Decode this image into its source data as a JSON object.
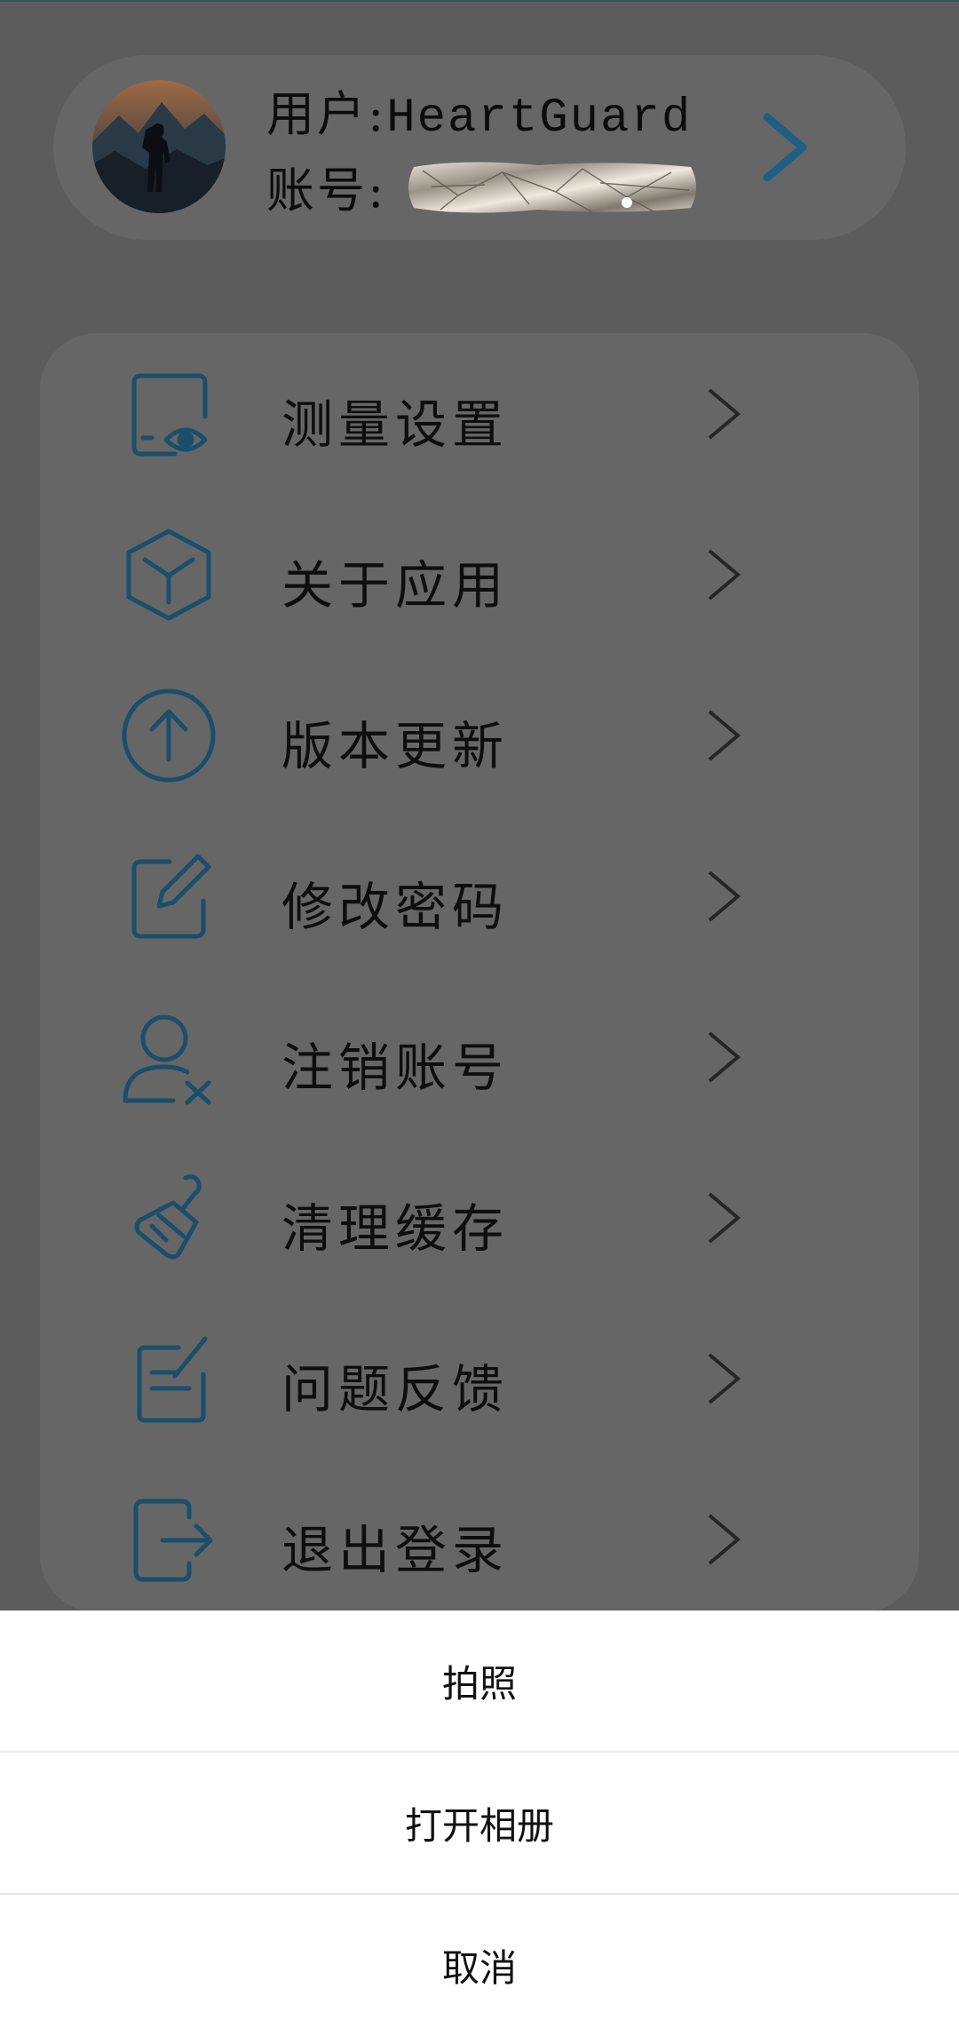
{
  "profile": {
    "user_label": "用户:",
    "user_name": "HeartGuard",
    "account_label": "账号:",
    "account_value_redacted": true
  },
  "menu": {
    "items": [
      {
        "label": "测量设置",
        "icon": "measure-settings-icon"
      },
      {
        "label": "关于应用",
        "icon": "cube-icon"
      },
      {
        "label": "版本更新",
        "icon": "upload-arrow-icon"
      },
      {
        "label": "修改密码",
        "icon": "edit-pencil-icon"
      },
      {
        "label": "注销账号",
        "icon": "user-remove-icon"
      },
      {
        "label": "清理缓存",
        "icon": "brush-icon"
      },
      {
        "label": "问题反馈",
        "icon": "feedback-icon"
      },
      {
        "label": "退出登录",
        "icon": "logout-icon"
      }
    ]
  },
  "sheet": {
    "take_photo": "拍照",
    "open_album": "打开相册",
    "cancel": "取消"
  },
  "colors": {
    "icon_blue": "#1b4e6b",
    "chevron_blue": "#1f5f86",
    "overlay_background": "#5c5c5c",
    "card_background": "#666666",
    "sheet_background": "#ffffff"
  }
}
